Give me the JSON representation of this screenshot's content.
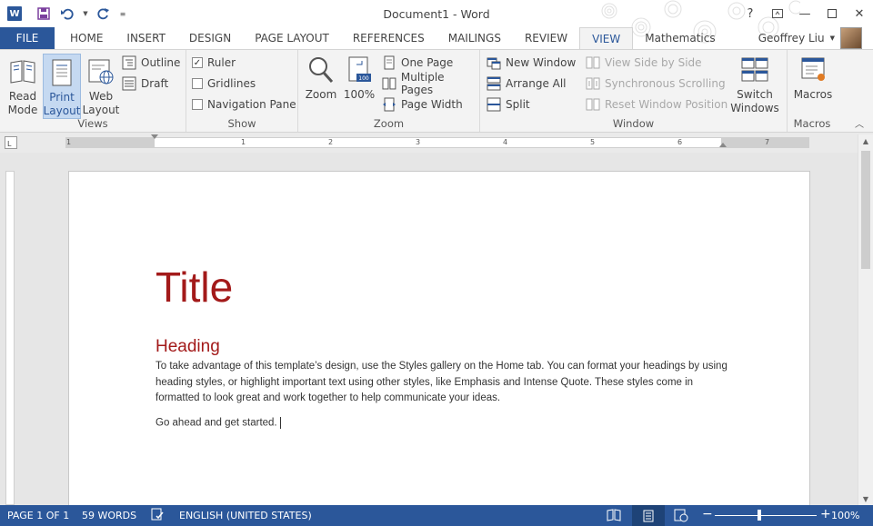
{
  "window": {
    "title": "Document1 - Word",
    "app_icon_letter": "W"
  },
  "tabs": {
    "file": "FILE",
    "items": [
      "HOME",
      "INSERT",
      "DESIGN",
      "PAGE LAYOUT",
      "REFERENCES",
      "MAILINGS",
      "REVIEW",
      "VIEW",
      "Mathematics"
    ],
    "active": "VIEW"
  },
  "user": {
    "name": "Geoffrey Liu"
  },
  "ribbon": {
    "views": {
      "label": "Views",
      "read_mode": "Read\nMode",
      "print_layout": "Print\nLayout",
      "web_layout": "Web\nLayout",
      "outline": "Outline",
      "draft": "Draft"
    },
    "show": {
      "label": "Show",
      "ruler": "Ruler",
      "ruler_checked": true,
      "gridlines": "Gridlines",
      "gridlines_checked": false,
      "navigation_pane": "Navigation Pane",
      "navigation_pane_checked": false
    },
    "zoom": {
      "label": "Zoom",
      "zoom": "Zoom",
      "hundred": "100%",
      "one_page": "One Page",
      "multiple_pages": "Multiple Pages",
      "page_width": "Page Width"
    },
    "window": {
      "label": "Window",
      "new_window": "New Window",
      "arrange_all": "Arrange All",
      "split": "Split",
      "view_side_by_side": "View Side by Side",
      "synchronous_scrolling": "Synchronous Scrolling",
      "reset_window_position": "Reset Window Position",
      "switch_windows": "Switch\nWindows"
    },
    "macros": {
      "label": "Macros",
      "macros": "Macros"
    }
  },
  "ruler": {
    "numbers": [
      "1",
      "1",
      "2",
      "3",
      "4",
      "5",
      "6",
      "7"
    ]
  },
  "document": {
    "title": "Title",
    "heading": "Heading",
    "paragraph": "To take advantage of this template’s design, use the Styles gallery on the Home tab. You can format your headings by using heading styles, or highlight important text using other styles, like Emphasis and Intense Quote. These styles come in formatted to look great and work together to help communicate your ideas.",
    "paragraph2": "Go ahead and get started."
  },
  "status": {
    "page": "PAGE 1 OF 1",
    "words": "59 WORDS",
    "language": "ENGLISH (UNITED STATES)",
    "zoom": "100%",
    "zoom_minus": "−",
    "zoom_plus": "+"
  },
  "colors": {
    "accent": "#2b579a",
    "doc_title": "#a31a1a"
  }
}
